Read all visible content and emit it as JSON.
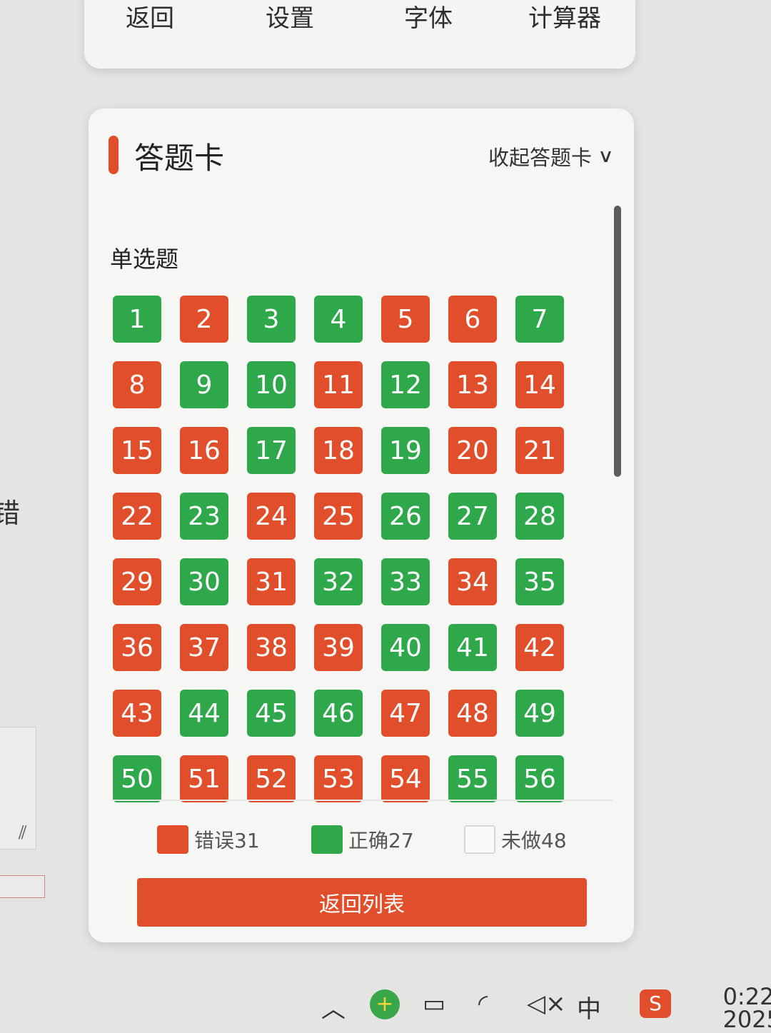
{
  "toolbar": {
    "back": "返回",
    "settings": "设置",
    "font": "字体",
    "calculator": "计算器"
  },
  "answer_card": {
    "title": "答题卡",
    "collapse_label": "收起答题卡",
    "section_title": "单选题",
    "questions": [
      {
        "n": "1",
        "s": "right"
      },
      {
        "n": "2",
        "s": "wrong"
      },
      {
        "n": "3",
        "s": "right"
      },
      {
        "n": "4",
        "s": "right"
      },
      {
        "n": "5",
        "s": "wrong"
      },
      {
        "n": "6",
        "s": "wrong"
      },
      {
        "n": "7",
        "s": "right"
      },
      {
        "n": "8",
        "s": "wrong"
      },
      {
        "n": "9",
        "s": "right"
      },
      {
        "n": "10",
        "s": "right"
      },
      {
        "n": "11",
        "s": "wrong"
      },
      {
        "n": "12",
        "s": "right"
      },
      {
        "n": "13",
        "s": "wrong"
      },
      {
        "n": "14",
        "s": "wrong"
      },
      {
        "n": "15",
        "s": "wrong"
      },
      {
        "n": "16",
        "s": "wrong"
      },
      {
        "n": "17",
        "s": "right"
      },
      {
        "n": "18",
        "s": "wrong"
      },
      {
        "n": "19",
        "s": "right"
      },
      {
        "n": "20",
        "s": "wrong"
      },
      {
        "n": "21",
        "s": "wrong"
      },
      {
        "n": "22",
        "s": "wrong"
      },
      {
        "n": "23",
        "s": "right"
      },
      {
        "n": "24",
        "s": "wrong"
      },
      {
        "n": "25",
        "s": "wrong"
      },
      {
        "n": "26",
        "s": "right"
      },
      {
        "n": "27",
        "s": "right"
      },
      {
        "n": "28",
        "s": "right"
      },
      {
        "n": "29",
        "s": "wrong"
      },
      {
        "n": "30",
        "s": "right"
      },
      {
        "n": "31",
        "s": "wrong"
      },
      {
        "n": "32",
        "s": "right"
      },
      {
        "n": "33",
        "s": "right"
      },
      {
        "n": "34",
        "s": "wrong"
      },
      {
        "n": "35",
        "s": "right"
      },
      {
        "n": "36",
        "s": "wrong"
      },
      {
        "n": "37",
        "s": "wrong"
      },
      {
        "n": "38",
        "s": "wrong"
      },
      {
        "n": "39",
        "s": "wrong"
      },
      {
        "n": "40",
        "s": "right"
      },
      {
        "n": "41",
        "s": "right"
      },
      {
        "n": "42",
        "s": "wrong"
      },
      {
        "n": "43",
        "s": "wrong"
      },
      {
        "n": "44",
        "s": "right"
      },
      {
        "n": "45",
        "s": "right"
      },
      {
        "n": "46",
        "s": "right"
      },
      {
        "n": "47",
        "s": "wrong"
      },
      {
        "n": "48",
        "s": "wrong"
      },
      {
        "n": "49",
        "s": "right"
      },
      {
        "n": "50",
        "s": "right"
      },
      {
        "n": "51",
        "s": "wrong"
      },
      {
        "n": "52",
        "s": "wrong"
      },
      {
        "n": "53",
        "s": "wrong"
      },
      {
        "n": "54",
        "s": "wrong"
      },
      {
        "n": "55",
        "s": "right"
      },
      {
        "n": "56",
        "s": "right"
      }
    ],
    "legend": {
      "wrong": "错误31",
      "right": "正确27",
      "undone": "未做48"
    },
    "return_button": "返回列表"
  },
  "background": {
    "left_edge_char": "错"
  },
  "taskbar": {
    "clock_time": "0:22",
    "clock_date": "2025",
    "ime": "中"
  },
  "colors": {
    "wrong": "#e04e2b",
    "right": "#2fa84c",
    "accent": "#e04e2b"
  },
  "icons": [
    "chevron-down-icon",
    "tray-expand-icon",
    "app-icon",
    "battery-icon",
    "wifi-icon",
    "volume-muted-icon",
    "ime-icon",
    "sogou-icon",
    "resize-icon"
  ]
}
